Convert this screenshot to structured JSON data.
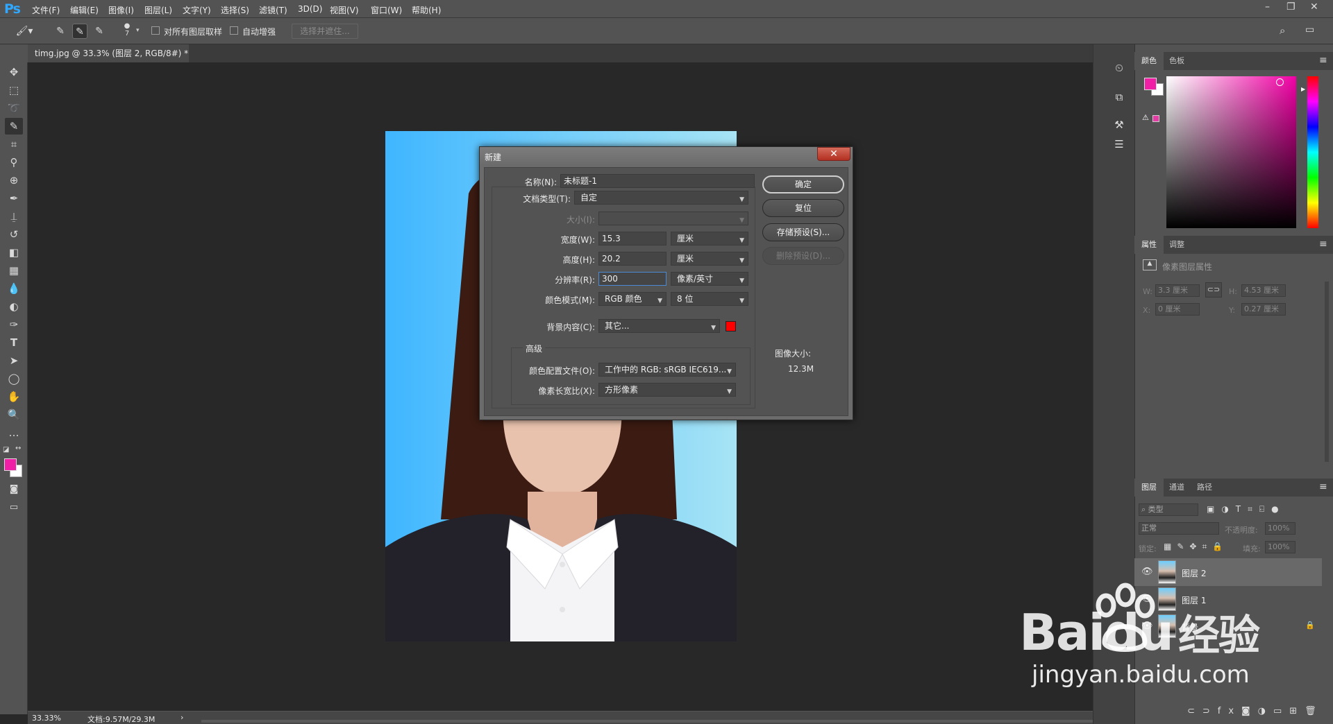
{
  "app": {
    "logo": "Ps"
  },
  "menu": [
    "文件(F)",
    "编辑(E)",
    "图像(I)",
    "图层(L)",
    "文字(Y)",
    "选择(S)",
    "滤镜(T)",
    "3D(D)",
    "视图(V)",
    "窗口(W)",
    "帮助(H)"
  ],
  "options": {
    "brush_size": "7",
    "sample_all_layers": "对所有图层取样",
    "auto_enhance": "自动增强",
    "select_and_mask": "选择并遮住..."
  },
  "document_tab": {
    "title": "timg.jpg @ 33.3% (图层 2, RGB/8#) *",
    "close": "×"
  },
  "status": {
    "zoom": "33.33%",
    "doc": "文档:9.57M/29.3M",
    "arrow": "›"
  },
  "color_panel": {
    "tabs": [
      "颜色",
      "色板"
    ],
    "foreground": "#ef1fa6",
    "background": "#ffffff"
  },
  "properties_panel": {
    "tabs": [
      "属性",
      "调整"
    ],
    "title": "像素图层属性",
    "w_label": "W:",
    "w_value": "3.3 厘米",
    "h_label": "H:",
    "h_value": "4.53 厘米",
    "x_label": "X:",
    "x_value": "0 厘米",
    "y_label": "Y:",
    "y_value": "0.27 厘米"
  },
  "layers_panel": {
    "tabs": [
      "图层",
      "通道",
      "路径"
    ],
    "filter_placeholder": "类型",
    "blend_mode": "正常",
    "opacity_label": "不透明度:",
    "opacity": "100%",
    "lock_label": "锁定:",
    "fill_label": "填充:",
    "fill": "100%",
    "layers": [
      {
        "name": "图层 2",
        "selected": true
      },
      {
        "name": "图层 1",
        "selected": false
      },
      {
        "name": "背景",
        "selected": false,
        "locked": true
      }
    ]
  },
  "dialog": {
    "title": "新建",
    "close": "✕",
    "name_label": "名称(N):",
    "name_value": "未标题-1",
    "doctype_label": "文档类型(T):",
    "doctype_value": "自定",
    "size_label": "大小(I):",
    "width_label": "宽度(W):",
    "width_value": "15.3",
    "width_unit": "厘米",
    "height_label": "高度(H):",
    "height_value": "20.2",
    "height_unit": "厘米",
    "resolution_label": "分辨率(R):",
    "resolution_value": "300",
    "resolution_unit": "像素/英寸",
    "colormode_label": "颜色模式(M):",
    "colormode_value": "RGB 颜色",
    "bitdepth_value": "8 位",
    "bg_label": "背景内容(C):",
    "bg_value": "其它...",
    "bg_swatch": "#ff0000",
    "advanced_label": "高级",
    "profile_label": "颜色配置文件(O):",
    "profile_value": "工作中的 RGB: sRGB IEC619...",
    "pixel_aspect_label": "像素长宽比(X):",
    "pixel_aspect_value": "方形像素",
    "ok": "确定",
    "reset": "复位",
    "save_preset": "存储预设(S)...",
    "delete_preset": "删除预设(D)...",
    "image_size_label": "图像大小:",
    "image_size_value": "12.3M"
  },
  "watermark": {
    "brand": "Baidu",
    "brand_cn": "经验",
    "url": "jingyan.baidu.com"
  }
}
